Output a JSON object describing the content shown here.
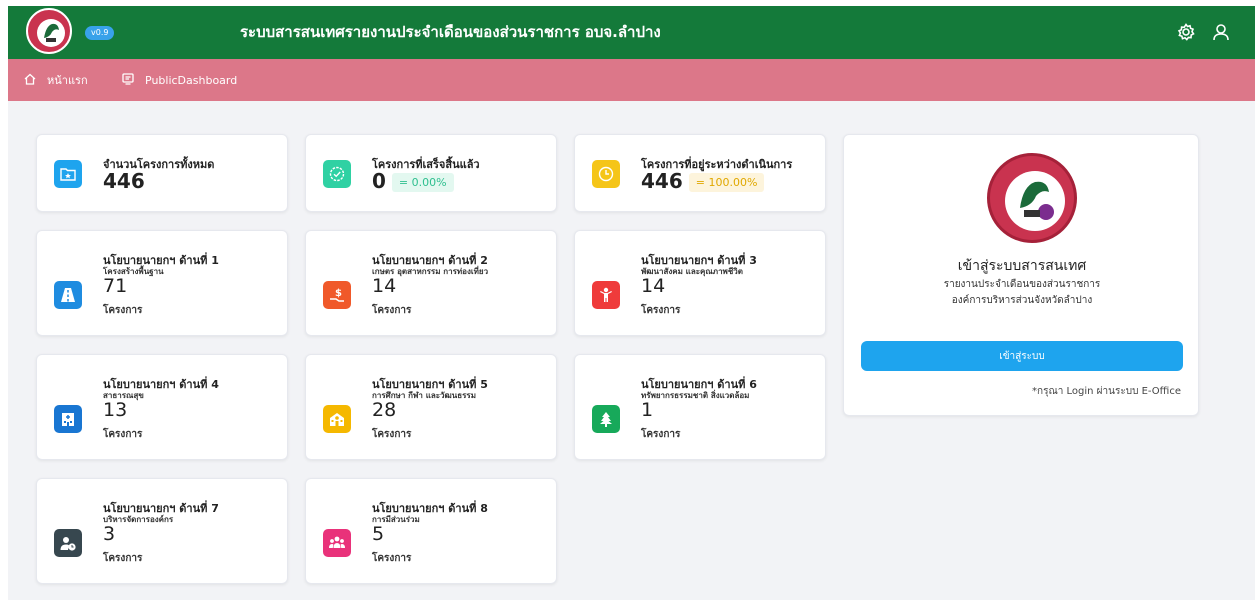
{
  "header": {
    "version": "v0.9",
    "title": "ระบบสารสนเทศรายงานประจำเดือนของส่วนราชการ อบจ.ลำปาง"
  },
  "nav": {
    "items": [
      {
        "label": "หน้าแรก",
        "icon": "home-icon"
      },
      {
        "label": "PublicDashboard",
        "icon": "dashboard-icon"
      }
    ]
  },
  "stats": [
    {
      "label": "จำนวนโครงการทั้งหมด",
      "value": "446",
      "icon": "folder-star-icon",
      "color": "#1ea4ee"
    },
    {
      "label": "โครงการที่เสร็จสิ้นแล้ว",
      "value": "0",
      "badge": "= 0.00%",
      "icon": "check-badge-icon",
      "color": "#2fd1a3"
    },
    {
      "label": "โครงการที่อยู่ระหว่างดำเนินการ",
      "value": "446",
      "badge": "= 100.00%",
      "icon": "clock-icon",
      "color": "#f5c518"
    }
  ],
  "policies": [
    {
      "title": "นโยบายนายกฯ ด้านที่ 1",
      "subtitle": "โครงสร้างพื้นฐาน",
      "count": "71",
      "unit": "โครงการ",
      "icon": "road-icon",
      "color": "#1f8ce0"
    },
    {
      "title": "นโยบายนายกฯ ด้านที่ 2",
      "subtitle": "เกษตร อุตสาหกรรม การท่องเที่ยว",
      "count": "14",
      "unit": "โครงการ",
      "icon": "hand-money-icon",
      "color": "#f0592a"
    },
    {
      "title": "นโยบายนายกฯ ด้านที่ 3",
      "subtitle": "พัฒนาสังคม และคุณภาพชีวิต",
      "count": "14",
      "unit": "โครงการ",
      "icon": "child-icon",
      "color": "#ef3b3b"
    },
    {
      "title": "นโยบายนายกฯ ด้านที่ 4",
      "subtitle": "สาธารณสุข",
      "count": "13",
      "unit": "โครงการ",
      "icon": "hospital-icon",
      "color": "#1976d2"
    },
    {
      "title": "นโยบายนายกฯ ด้านที่ 5",
      "subtitle": "การศึกษา กีฬา และวัฒนธรรม",
      "count": "28",
      "unit": "โครงการ",
      "icon": "school-icon",
      "color": "#f5b800"
    },
    {
      "title": "นโยบายนายกฯ ด้านที่ 6",
      "subtitle": "ทรัพยากรธรรมชาติ สิ่งแวดล้อม",
      "count": "1",
      "unit": "โครงการ",
      "icon": "tree-icon",
      "color": "#17a95a"
    },
    {
      "title": "นโยบายนายกฯ ด้านที่ 7",
      "subtitle": "บริหารจัดการองค์กร",
      "count": "3",
      "unit": "โครงการ",
      "icon": "user-clock-icon",
      "color": "#37474f"
    },
    {
      "title": "นโยบายนายกฯ ด้านที่ 8",
      "subtitle": "การมีส่วนร่วม",
      "count": "5",
      "unit": "โครงการ",
      "icon": "people-group-icon",
      "color": "#e9327a"
    }
  ],
  "login": {
    "title": "เข้าสู่ระบบสารสนเทศ",
    "subtitle1": "รายงานประจำเดือนของส่วนราชการ",
    "subtitle2": "องค์การบริหารส่วนจังหวัดลำปาง",
    "button": "เข้าสู่ระบบ",
    "note": "*กรุณา Login ผ่านระบบ E-Office",
    "seal_text": "องค์การบริหารส่วนจังหวัดลำปาง"
  }
}
